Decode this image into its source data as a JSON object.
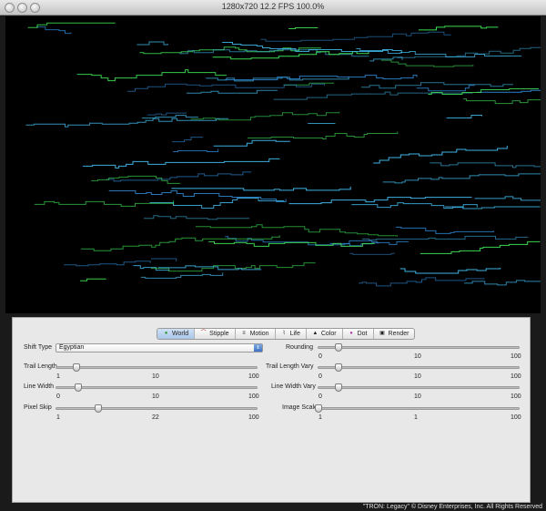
{
  "window": {
    "title": "1280x720 12.2 FPS 100.0%",
    "copyright": "\"TRON: Legacy\" © Disney Enterprises, Inc. All Rights Reserved"
  },
  "tabs": [
    {
      "label": "World",
      "icon": "world-icon",
      "active": true
    },
    {
      "label": "Stipple",
      "icon": "stipple-icon",
      "active": false
    },
    {
      "label": "Motion",
      "icon": "motion-icon",
      "active": false
    },
    {
      "label": "Life",
      "icon": "life-icon",
      "active": false
    },
    {
      "label": "Color",
      "icon": "color-icon",
      "active": false
    },
    {
      "label": "Dot",
      "icon": "dot-icon",
      "active": false
    },
    {
      "label": "Render",
      "icon": "render-icon",
      "active": false
    }
  ],
  "controls": {
    "shift_type": {
      "label": "Shift Type",
      "value": "Egyptian"
    },
    "rounding": {
      "label": "Rounding",
      "min": "0",
      "mid": "10",
      "max": "100",
      "fraction": 0.1
    },
    "trail_length": {
      "label": "Trail Length",
      "min": "1",
      "mid": "10",
      "max": "100",
      "fraction": 0.1
    },
    "trail_length_vary": {
      "label": "Trail Length Vary",
      "min": "0",
      "mid": "10",
      "max": "100",
      "fraction": 0.1
    },
    "line_width": {
      "label": "Line Width",
      "min": "0",
      "mid": "10",
      "max": "100",
      "fraction": 0.11
    },
    "line_width_vary": {
      "label": "Line Width Vary",
      "min": "0",
      "mid": "10",
      "max": "100",
      "fraction": 0.1
    },
    "pixel_skip": {
      "label": "Pixel Skip",
      "min": "1",
      "mid": "22",
      "max": "100",
      "fraction": 0.21
    },
    "image_scale": {
      "label": "Image Scale",
      "min": "1",
      "mid": "1",
      "max": "100",
      "fraction": 0.0
    }
  },
  "colors": {
    "trail_green": "#3dde55",
    "trail_cyan": "#3fb6e8",
    "trail_blue": "#2f86d2",
    "background": "#000000"
  }
}
